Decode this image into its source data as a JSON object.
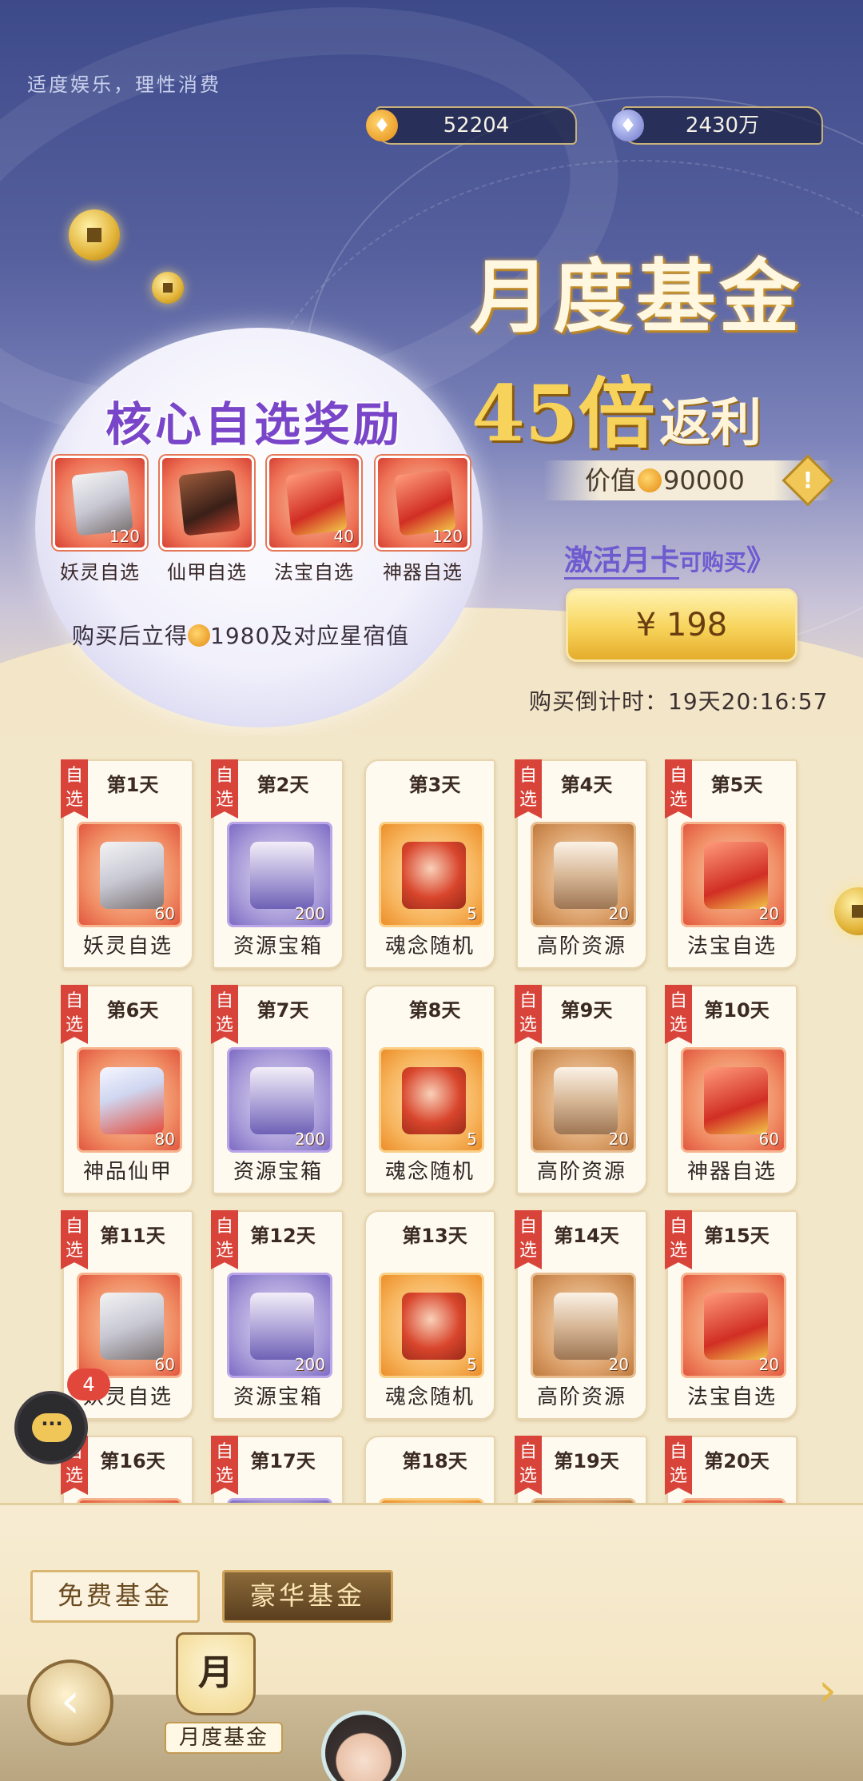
{
  "header": {
    "slogan": "适度娱乐，理性消费",
    "gold_amount": "52204",
    "jade_amount": "2430万",
    "gold_icon": "gold-ingot-icon",
    "jade_icon": "jade-gem-icon"
  },
  "promo": {
    "title": "月度基金",
    "multiplier": "45倍",
    "rebate": "返利",
    "value_label": "价值",
    "value_amount": "90000",
    "activate_text": "激活月卡",
    "activate_suffix": "可购买",
    "activate_arrow": "》",
    "price": "¥ 198",
    "countdown": "购买倒计时：19天20:16:57",
    "info_icon": "!"
  },
  "core_rewards": {
    "title": "核心自选奖励",
    "items": [
      {
        "name": "妖灵自选",
        "count": "120"
      },
      {
        "name": "仙甲自选",
        "count": ""
      },
      {
        "name": "法宝自选",
        "count": "40"
      },
      {
        "name": "神器自选",
        "count": "120"
      }
    ],
    "note_prefix": "购买后立得",
    "note_suffix": "1980及对应星宿值"
  },
  "days": [
    {
      "day": "第1天",
      "tag": "自选",
      "label": "妖灵自选",
      "qty": "60"
    },
    {
      "day": "第2天",
      "tag": "自选",
      "label": "资源宝箱",
      "qty": "200"
    },
    {
      "day": "第3天",
      "tag": "",
      "label": "魂念随机",
      "qty": "5"
    },
    {
      "day": "第4天",
      "tag": "自选",
      "label": "高阶资源",
      "qty": "20"
    },
    {
      "day": "第5天",
      "tag": "自选",
      "label": "法宝自选",
      "qty": "20"
    },
    {
      "day": "第6天",
      "tag": "自选",
      "label": "神品仙甲",
      "qty": "80"
    },
    {
      "day": "第7天",
      "tag": "自选",
      "label": "资源宝箱",
      "qty": "200"
    },
    {
      "day": "第8天",
      "tag": "",
      "label": "魂念随机",
      "qty": "5"
    },
    {
      "day": "第9天",
      "tag": "自选",
      "label": "高阶资源",
      "qty": "20"
    },
    {
      "day": "第10天",
      "tag": "自选",
      "label": "神器自选",
      "qty": "60"
    },
    {
      "day": "第11天",
      "tag": "自选",
      "label": "妖灵自选",
      "qty": "60"
    },
    {
      "day": "第12天",
      "tag": "自选",
      "label": "资源宝箱",
      "qty": "200"
    },
    {
      "day": "第13天",
      "tag": "",
      "label": "魂念随机",
      "qty": "5"
    },
    {
      "day": "第14天",
      "tag": "自选",
      "label": "高阶资源",
      "qty": "20"
    },
    {
      "day": "第15天",
      "tag": "自选",
      "label": "法宝自选",
      "qty": "20"
    },
    {
      "day": "第16天",
      "tag": "自选",
      "label": "",
      "qty": ""
    },
    {
      "day": "第17天",
      "tag": "自选",
      "label": "",
      "qty": ""
    },
    {
      "day": "第18天",
      "tag": "",
      "label": "",
      "qty": ""
    },
    {
      "day": "第19天",
      "tag": "自选",
      "label": "",
      "qty": ""
    },
    {
      "day": "第20天",
      "tag": "自选",
      "label": "",
      "qty": ""
    }
  ],
  "tabs": {
    "free": "免费基金",
    "deluxe": "豪华基金"
  },
  "nav": {
    "back_icon": "‹",
    "lantern_char": "月",
    "lantern_label": "月度基金",
    "next_icon": "›"
  },
  "chat": {
    "badge": "4",
    "icon": "···"
  }
}
